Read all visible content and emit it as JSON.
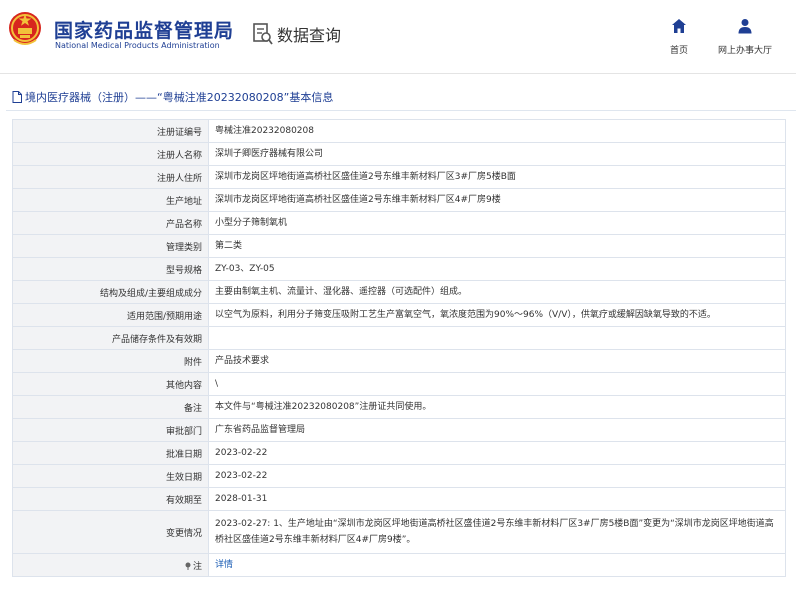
{
  "header": {
    "brand_cn": "国家药品监督管理局",
    "brand_en": "National Medical Products Administration",
    "query_label": "数据查询",
    "nav": [
      {
        "label": "首页",
        "icon": "home-icon"
      },
      {
        "label": "网上办事大厅",
        "icon": "user-icon"
      }
    ]
  },
  "title_bar": {
    "icon": "document-icon",
    "text": "境内医疗器械（注册）——“粤械注准20232080208”基本信息"
  },
  "rows": [
    {
      "key": "注册证编号",
      "value": "粤械注准20232080208"
    },
    {
      "key": "注册人名称",
      "value": "深圳子卿医疗器械有限公司"
    },
    {
      "key": "注册人住所",
      "value": "深圳市龙岗区坪地街道高桥社区盛佳道2号东维丰新材料厂区3#厂房5楼B面"
    },
    {
      "key": "生产地址",
      "value": "深圳市龙岗区坪地街道高桥社区盛佳道2号东维丰新材料厂区4#厂房9楼"
    },
    {
      "key": "产品名称",
      "value": "小型分子筛制氧机"
    },
    {
      "key": "管理类别",
      "value": "第二类"
    },
    {
      "key": "型号规格",
      "value": "ZY-03、ZY-05"
    },
    {
      "key": "结构及组成/主要组成成分",
      "value": "主要由制氧主机、流量计、湿化器、遥控器（可选配件）组成。"
    },
    {
      "key": "适用范围/预期用途",
      "value": "以空气为原料，利用分子筛变压吸附工艺生产富氧空气，氧浓度范围为90%～96%（V/V），供氧疗或缓解因缺氧导致的不适。"
    },
    {
      "key": "产品储存条件及有效期",
      "value": ""
    },
    {
      "key": "附件",
      "value": "产品技术要求"
    },
    {
      "key": "其他内容",
      "value": "\\"
    },
    {
      "key": "备注",
      "value": "本文件与“粤械注准20232080208”注册证共同使用。"
    },
    {
      "key": "审批部门",
      "value": "广东省药品监督管理局"
    },
    {
      "key": "批准日期",
      "value": "2023-02-22"
    },
    {
      "key": "生效日期",
      "value": "2023-02-22"
    },
    {
      "key": "有效期至",
      "value": "2028-01-31"
    },
    {
      "key": "变更情况",
      "value": "2023-02-27: 1、生产地址由“深圳市龙岗区坪地街道高桥社区盛佳道2号东维丰新材料厂区3#厂房5楼B面”变更为“深圳市龙岗区坪地街道高桥社区盛佳道2号东维丰新材料厂区4#厂房9楼”。"
    },
    {
      "key": "注",
      "value": "详情",
      "icon": "pin-icon"
    }
  ],
  "colors": {
    "brand": "#1f3f94",
    "link": "#1a5cb4",
    "label_bg": "#f2f3f5",
    "border": "#dde3ec",
    "emblem_red": "#d7261e",
    "emblem_gold": "#f2c23a"
  }
}
